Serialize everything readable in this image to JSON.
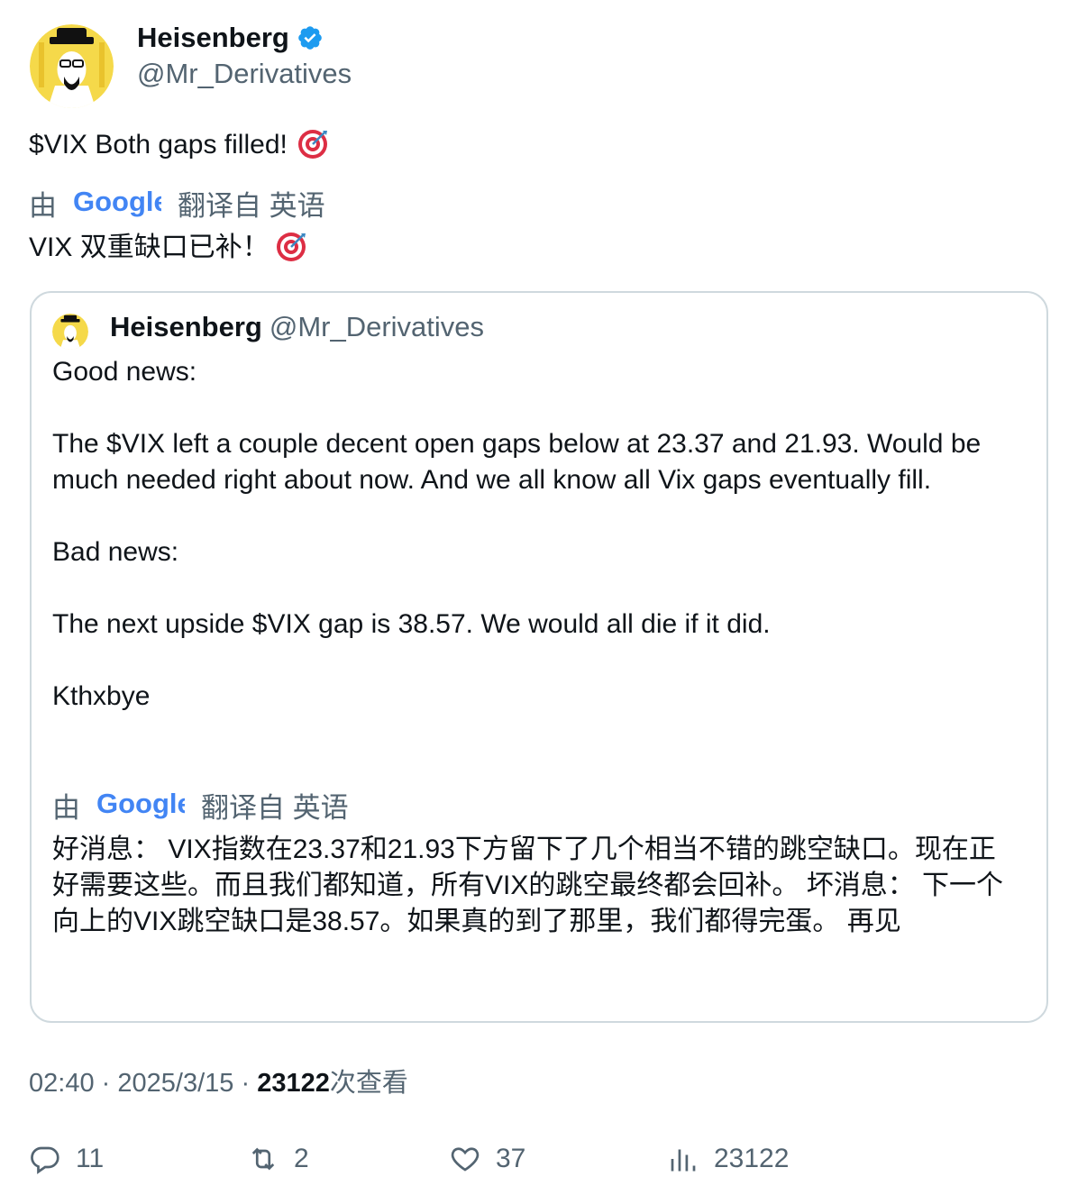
{
  "author": {
    "name": "Heisenberg",
    "handle": "@Mr_Derivatives"
  },
  "tweet": {
    "text": "$VIX Both gaps filled!",
    "translate": {
      "prefix": "由",
      "provider": "Google",
      "suffix": "翻译自 英语"
    },
    "translated_text": "VIX 双重缺口已补！"
  },
  "quote": {
    "name": "Heisenberg",
    "handle": "@Mr_Derivatives",
    "body": "Good news:\n\nThe $VIX left a couple decent open gaps below at 23.37 and 21.93. Would be much needed right about now. And we all know all Vix gaps eventually fill.\n\nBad news:\n\nThe next upside $VIX gap is 38.57. We would all die if it did.\n\nKthxbye",
    "translate": {
      "prefix": "由",
      "provider": "Google",
      "suffix": "翻译自 英语"
    },
    "translated_text": "好消息： VIX指数在23.37和21.93下方留下了几个相当不错的跳空缺口。现在正好需要这些。而且我们都知道，所有VIX的跳空最终都会回补。 坏消息： 下一个向上的VIX跳空缺口是38.57。如果真的到了那里，我们都得完蛋。 再见"
  },
  "meta": {
    "time": "02:40",
    "sep": "·",
    "date": "2025/3/15",
    "views": "23122",
    "views_label": "次查看"
  },
  "actions": {
    "replies": "11",
    "reposts": "2",
    "likes": "37",
    "views": "23122"
  },
  "colors": {
    "verified": "#1d9bf0",
    "muted": "#536471",
    "border": "#cfd9de"
  },
  "icons": [
    "verified-badge-icon",
    "target-emoji-icon",
    "google-logo",
    "reply-icon",
    "repost-icon",
    "like-icon",
    "views-icon"
  ]
}
